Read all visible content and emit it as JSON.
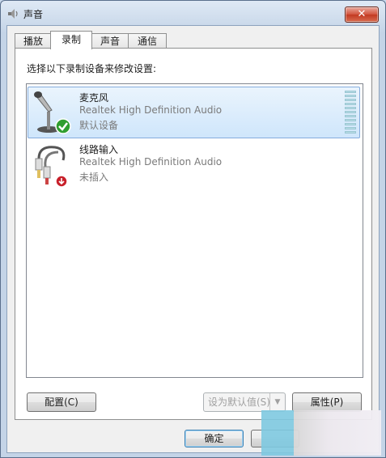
{
  "window": {
    "title": "声音",
    "close_label": "✕"
  },
  "tabs": [
    {
      "label": "播放"
    },
    {
      "label": "录制"
    },
    {
      "label": "声音"
    },
    {
      "label": "通信"
    }
  ],
  "panel": {
    "instruction": "选择以下录制设备来修改设置:"
  },
  "devices": [
    {
      "name": "麦克风",
      "driver": "Realtek High Definition Audio",
      "status": "默认设备",
      "icon": "microphone-icon",
      "badge": "default-check-icon"
    },
    {
      "name": "线路输入",
      "driver": "Realtek High Definition Audio",
      "status": "未插入",
      "icon": "line-in-cable-icon",
      "badge": "unplugged-arrow-icon"
    }
  ],
  "buttons": {
    "configure": "配置(C)",
    "set_default": "设为默认值(S)",
    "properties": "属性(P)",
    "ok": "确定"
  },
  "colors": {
    "selection_top": "#eaf4fd",
    "selection_bottom": "#cfe6fb",
    "selection_border": "#84acdd",
    "close_button": "#c23a22",
    "check_badge": "#2f9e2f",
    "unplugged_badge": "#c8202a"
  }
}
